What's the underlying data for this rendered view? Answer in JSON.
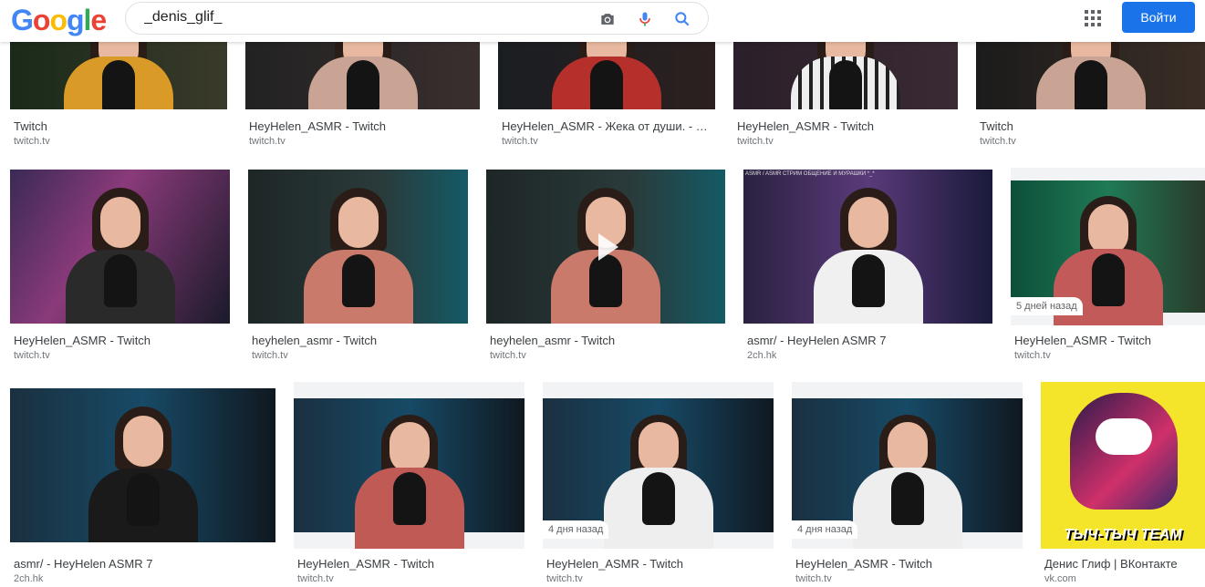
{
  "header": {
    "logo_letters": [
      "G",
      "o",
      "o",
      "g",
      "l",
      "e"
    ],
    "search_value": "_denis_glif_",
    "signin_label": "Войти",
    "icons": [
      "camera-icon",
      "microphone-icon",
      "search-icon",
      "apps-grid-icon"
    ]
  },
  "colors": {
    "accent": "#1a73e8",
    "title": "#3c4043",
    "source": "#70757a"
  },
  "results": [
    {
      "title": "Twitch",
      "source": "twitch.tv"
    },
    {
      "title": "HeyHelen_ASMR - Twitch",
      "source": "twitch.tv"
    },
    {
      "title": "HeyHelen_ASMR - Жека от души. - Twit…",
      "source": "twitch.tv"
    },
    {
      "title": "HeyHelen_ASMR - Twitch",
      "source": "twitch.tv"
    },
    {
      "title": "Twitch",
      "source": "twitch.tv"
    },
    {
      "title": "HeyHelen_ASMR - Twitch",
      "source": "twitch.tv"
    },
    {
      "title": "heyhelen_asmr - Twitch",
      "source": "twitch.tv"
    },
    {
      "title": "heyhelen_asmr - Twitch",
      "source": "twitch.tv"
    },
    {
      "title": "asmr/ - HeyHelen ASMR 7",
      "source": "2ch.hk",
      "overlay": "ASMR / ASMR СТРИМ ОБЩЕНИЕ И МУРАШКИ *_*"
    },
    {
      "title": "HeyHelen_ASMR - Twitch",
      "source": "twitch.tv",
      "badge": "5 дней назад"
    },
    {
      "title": "asmr/ - HeyHelen ASMR 7",
      "source": "2ch.hk"
    },
    {
      "title": "HeyHelen_ASMR - Twitch",
      "source": "twitch.tv"
    },
    {
      "title": "HeyHelen_ASMR - Twitch",
      "source": "twitch.tv",
      "badge": "4 дня назад"
    },
    {
      "title": "HeyHelen_ASMR - Twitch",
      "source": "twitch.tv",
      "badge": "4 дня назад"
    },
    {
      "title": "Денис Глиф | ВКонтакте",
      "source": "vk.com",
      "overlay": "ТЫЧ-ТЫЧ TEAM"
    }
  ]
}
